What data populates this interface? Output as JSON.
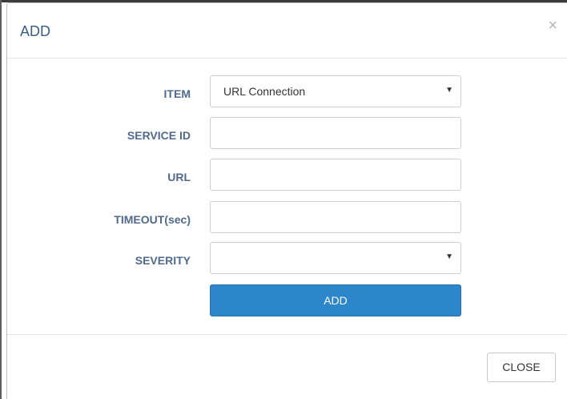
{
  "dialog": {
    "title": "ADD",
    "close_icon": "close-icon",
    "close_glyph": "×"
  },
  "form": {
    "item_label": "ITEM",
    "item_value": "URL Connection",
    "service_id_label": "SERVICE ID",
    "service_id_value": "",
    "url_label": "URL",
    "url_value": "",
    "timeout_label": "TIMEOUT(sec)",
    "timeout_value": "",
    "severity_label": "SEVERITY",
    "severity_value": "",
    "dropdown_icon": "chevron-down-icon",
    "dropdown_glyph": "▼",
    "add_label": "ADD"
  },
  "footer": {
    "close_label": "CLOSE"
  },
  "colors": {
    "title": "#3b5d85",
    "label": "#4f6a8c",
    "primary": "#2d86c9"
  }
}
